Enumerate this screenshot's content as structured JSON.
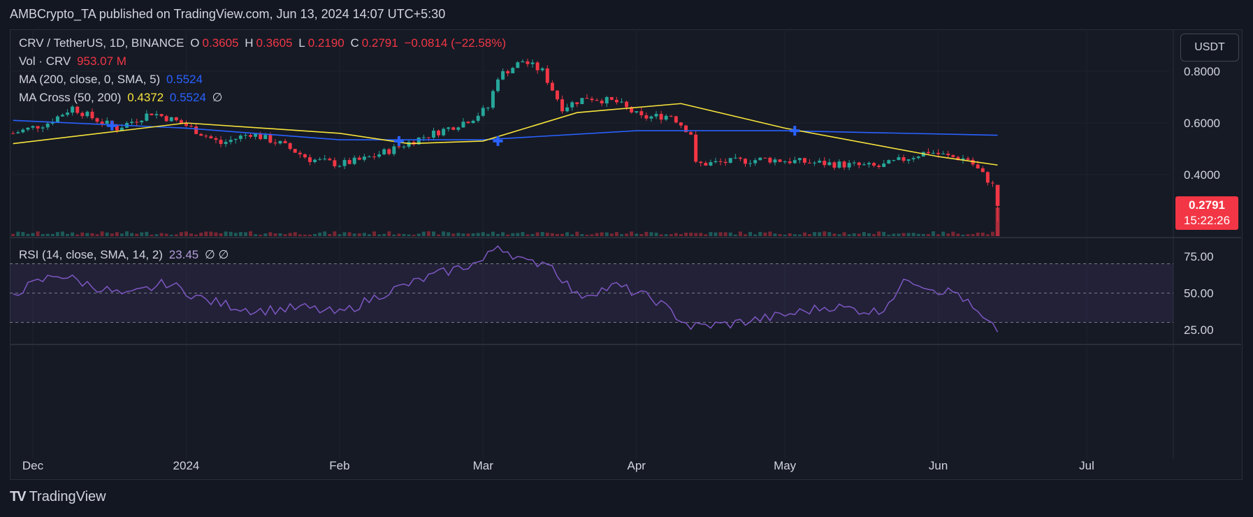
{
  "header": {
    "publisher": "AMBCrypto_TA published on TradingView.com, Jun 13, 2024 14:07 UTC+5:30"
  },
  "legend": {
    "symbol": "CRV / TetherUS, 1D, BINANCE",
    "open_label": "O",
    "open": "0.3605",
    "high_label": "H",
    "high": "0.3605",
    "low_label": "L",
    "low": "0.2190",
    "close_label": "C",
    "close": "0.2791",
    "change": "−0.0814 (−22.58%)",
    "vol_label": "Vol · CRV",
    "vol_value": "953.07 M",
    "ma_label": "MA (200, close, 0, SMA, 5)",
    "ma_value": "0.5524",
    "cross_label": "MA Cross (50, 200)",
    "cross_fast": "0.4372",
    "cross_slow": "0.5524",
    "cross_extra": "∅",
    "rsi_label": "RSI (14, close, SMA, 14, 2)",
    "rsi_value": "23.45",
    "rsi_extra": "∅ ∅"
  },
  "currency_button": "USDT",
  "price_tag": {
    "price": "0.2791",
    "countdown": "15:22:26"
  },
  "footer": {
    "brand": "TradingView",
    "logo_glyph": "TV"
  },
  "colors": {
    "up": "#26a69a",
    "down": "#f23645",
    "ma200": "#2962ff",
    "ma50": "#f7e33b",
    "rsi": "#7e57c2"
  },
  "chart_data": {
    "type": "candlestick",
    "x_ticks": [
      "Dec",
      "2024",
      "Feb",
      "Mar",
      "Apr",
      "May",
      "Jun",
      "Jul"
    ],
    "price_ticks": [
      "0.8000",
      "0.6000",
      "0.4000"
    ],
    "rsi_ticks": [
      "75.00",
      "50.00",
      "25.00"
    ],
    "rsi_bands": [
      70,
      50,
      30
    ],
    "close_path": [
      [
        "2023-11-27",
        0.56
      ],
      [
        "2023-12-04",
        0.6
      ],
      [
        "2023-12-09",
        0.66
      ],
      [
        "2023-12-13",
        0.62
      ],
      [
        "2023-12-18",
        0.58
      ],
      [
        "2023-12-25",
        0.64
      ],
      [
        "2023-12-31",
        0.6
      ],
      [
        "2024-01-04",
        0.56
      ],
      [
        "2024-01-08",
        0.52
      ],
      [
        "2024-01-14",
        0.56
      ],
      [
        "2024-01-20",
        0.52
      ],
      [
        "2024-01-26",
        0.46
      ],
      [
        "2024-02-01",
        0.44
      ],
      [
        "2024-02-06",
        0.46
      ],
      [
        "2024-02-12",
        0.5
      ],
      [
        "2024-02-17",
        0.54
      ],
      [
        "2024-02-23",
        0.58
      ],
      [
        "2024-02-28",
        0.62
      ],
      [
        "2024-03-02",
        0.66
      ],
      [
        "2024-03-04",
        0.78
      ],
      [
        "2024-03-09",
        0.84
      ],
      [
        "2024-03-13",
        0.8
      ],
      [
        "2024-03-17",
        0.66
      ],
      [
        "2024-03-22",
        0.7
      ],
      [
        "2024-03-28",
        0.68
      ],
      [
        "2024-04-02",
        0.62
      ],
      [
        "2024-04-08",
        0.63
      ],
      [
        "2024-04-12",
        0.56
      ],
      [
        "2024-04-13",
        0.44
      ],
      [
        "2024-04-20",
        0.45
      ],
      [
        "2024-04-27",
        0.46
      ],
      [
        "2024-05-04",
        0.45
      ],
      [
        "2024-05-12",
        0.44
      ],
      [
        "2024-05-20",
        0.43
      ],
      [
        "2024-05-25",
        0.46
      ],
      [
        "2024-05-30",
        0.49
      ],
      [
        "2024-06-03",
        0.47
      ],
      [
        "2024-06-07",
        0.46
      ],
      [
        "2024-06-10",
        0.4
      ],
      [
        "2024-06-12",
        0.36
      ],
      [
        "2024-06-13",
        0.2791
      ]
    ],
    "last_candle": {
      "date": "2024-06-13",
      "open": 0.3605,
      "high": 0.3605,
      "low": 0.219,
      "close": 0.2791
    },
    "ma200": [
      [
        "2023-11-27",
        0.61
      ],
      [
        "2024-01-01",
        0.58
      ],
      [
        "2024-02-01",
        0.535
      ],
      [
        "2024-03-01",
        0.535
      ],
      [
        "2024-04-01",
        0.57
      ],
      [
        "2024-05-01",
        0.57
      ],
      [
        "2024-06-13",
        0.5524
      ]
    ],
    "ma50": [
      [
        "2023-11-27",
        0.52
      ],
      [
        "2024-01-01",
        0.6
      ],
      [
        "2024-02-01",
        0.56
      ],
      [
        "2024-02-15",
        0.52
      ],
      [
        "2024-03-01",
        0.53
      ],
      [
        "2024-03-20",
        0.64
      ],
      [
        "2024-04-10",
        0.675
      ],
      [
        "2024-05-01",
        0.58
      ],
      [
        "2024-06-01",
        0.47
      ],
      [
        "2024-06-13",
        0.4372
      ]
    ],
    "cross_markers": [
      [
        "2023-12-17",
        0.59
      ],
      [
        "2024-02-13",
        0.53
      ],
      [
        "2024-03-04",
        0.53
      ],
      [
        "2024-05-03",
        0.57
      ]
    ],
    "rsi": [
      [
        "2023-11-27",
        50
      ],
      [
        "2023-12-06",
        63
      ],
      [
        "2023-12-13",
        55
      ],
      [
        "2023-12-20",
        48
      ],
      [
        "2023-12-28",
        57
      ],
      [
        "2024-01-05",
        45
      ],
      [
        "2024-01-15",
        38
      ],
      [
        "2024-01-25",
        40
      ],
      [
        "2024-02-01",
        36
      ],
      [
        "2024-02-10",
        50
      ],
      [
        "2024-02-20",
        62
      ],
      [
        "2024-03-01",
        72
      ],
      [
        "2024-03-04",
        83
      ],
      [
        "2024-03-10",
        70
      ],
      [
        "2024-03-14",
        72
      ],
      [
        "2024-03-20",
        48
      ],
      [
        "2024-03-28",
        55
      ],
      [
        "2024-04-05",
        45
      ],
      [
        "2024-04-12",
        27
      ],
      [
        "2024-04-20",
        29
      ],
      [
        "2024-05-01",
        35
      ],
      [
        "2024-05-10",
        41
      ],
      [
        "2024-05-20",
        37
      ],
      [
        "2024-05-26",
        60
      ],
      [
        "2024-06-01",
        52
      ],
      [
        "2024-06-05",
        50
      ],
      [
        "2024-06-10",
        32
      ],
      [
        "2024-06-13",
        23.45
      ]
    ]
  }
}
